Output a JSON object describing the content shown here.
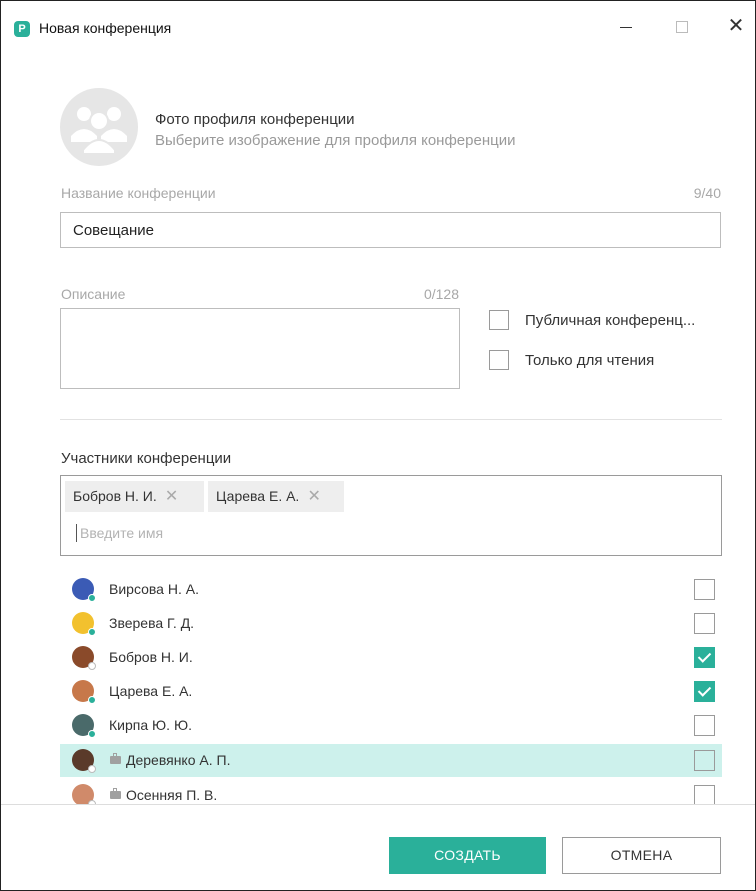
{
  "window": {
    "title": "Новая конференция",
    "app_icon_glyph": "P",
    "accent_color": "#2ab09a"
  },
  "profile_photo": {
    "title": "Фото профиля конференции",
    "subtitle": "Выберите изображение для профиля конференции",
    "icon": "group-avatar-icon"
  },
  "name_field": {
    "label": "Название конференции",
    "counter": "9/40",
    "value": "Совещание"
  },
  "description_field": {
    "label": "Описание",
    "counter": "0/128",
    "value": ""
  },
  "options": {
    "public_label": "Публичная конференц...",
    "public_checked": false,
    "readonly_label": "Только для чтения",
    "readonly_checked": false
  },
  "participants": {
    "title": "Участники конференции",
    "selected": [
      "Бобров Н. И.",
      "Царева Е. А."
    ],
    "search_placeholder": "Введите имя"
  },
  "contacts": [
    {
      "name": "Вирсова Н. А.",
      "checked": false,
      "status": "online",
      "status_color": "#2ab09a",
      "avatar_color": "#3b5bb5",
      "briefcase": false,
      "highlighted": false
    },
    {
      "name": "Зверева Г. Д.",
      "checked": false,
      "status": "online",
      "status_color": "#2ab09a",
      "avatar_color": "#f2c12e",
      "briefcase": false,
      "highlighted": false
    },
    {
      "name": "Бобров Н. И.",
      "checked": true,
      "status": "offline",
      "status_color": "#ffffff",
      "avatar_color": "#8a4a2a",
      "briefcase": false,
      "highlighted": false
    },
    {
      "name": "Царева Е. А.",
      "checked": true,
      "status": "online",
      "status_color": "#2ab09a",
      "avatar_color": "#c7784a",
      "briefcase": false,
      "highlighted": false
    },
    {
      "name": "Кирпа Ю. Ю.",
      "checked": false,
      "status": "online",
      "status_color": "#2ab09a",
      "avatar_color": "#4a6a6a",
      "briefcase": false,
      "highlighted": false
    },
    {
      "name": "Деревянко А. П.",
      "checked": false,
      "status": "offline",
      "status_color": "#ffffff",
      "avatar_color": "#5a3a2a",
      "briefcase": true,
      "highlighted": true
    },
    {
      "name": "Осенняя П. В.",
      "checked": false,
      "status": "offline",
      "status_color": "#ffffff",
      "avatar_color": "#d08a6a",
      "briefcase": true,
      "highlighted": false
    }
  ],
  "buttons": {
    "create": "СОЗДАТЬ",
    "cancel": "ОТМЕНА"
  }
}
